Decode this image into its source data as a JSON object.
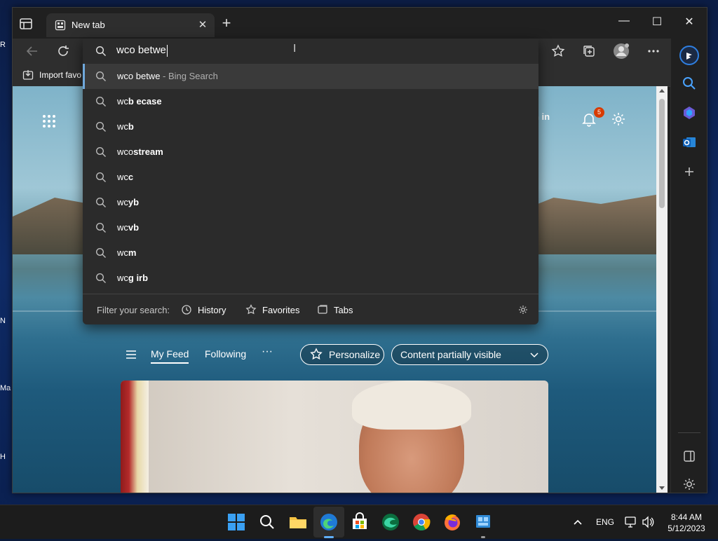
{
  "browser": {
    "tab_title": "New tab",
    "address_value": "wco betwe",
    "favorites_bar": {
      "import_label": "Import favo"
    }
  },
  "suggestions": {
    "items": [
      {
        "prefix": "wco betwe",
        "bold": "",
        "suffix": " - Bing Search"
      },
      {
        "prefix": "wc",
        "bold": "b ecase",
        "suffix": ""
      },
      {
        "prefix": "wc",
        "bold": "b",
        "suffix": ""
      },
      {
        "prefix": "wco",
        "bold": "stream",
        "suffix": ""
      },
      {
        "prefix": "wc",
        "bold": "c",
        "suffix": ""
      },
      {
        "prefix": "wc",
        "bold": "yb",
        "suffix": ""
      },
      {
        "prefix": "wc",
        "bold": "vb",
        "suffix": ""
      },
      {
        "prefix": "wc",
        "bold": "m",
        "suffix": ""
      },
      {
        "prefix": "wc",
        "bold": "g irb",
        "suffix": ""
      }
    ],
    "filter_label": "Filter your search:",
    "filters": [
      "History",
      "Favorites",
      "Tabs"
    ]
  },
  "newtab": {
    "signin_label": "gn in",
    "notification_count": "5",
    "feed_tabs": [
      "My Feed",
      "Following"
    ],
    "more_label": "···",
    "personalize_label": "Personalize",
    "content_visibility_label": "Content partially visible"
  },
  "desktop_fragments": [
    "R",
    "N",
    "Ma",
    "H"
  ],
  "taskbar": {
    "language": "ENG",
    "time": "8:44 AM",
    "date": "5/12/2023"
  },
  "colors": {
    "accent": "#6fa8dc",
    "badge": "#d83b01",
    "edge_blue": "#1f7ad6"
  }
}
